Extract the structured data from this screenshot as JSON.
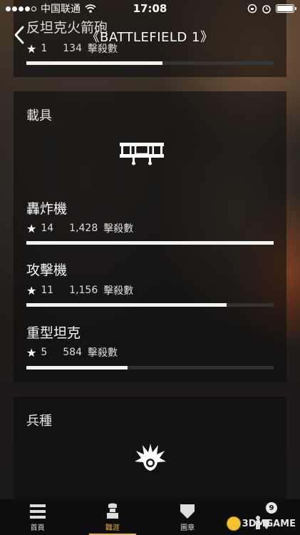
{
  "status_bar": {
    "carrier": "中国联通",
    "time": "17:08"
  },
  "header": {
    "title": "《BATTLEFIELD 1》"
  },
  "top_card": {
    "name": "反坦克火箭砲",
    "rank": "1",
    "kills": "134",
    "kills_label": "擊殺數",
    "progress": 0.55
  },
  "vehicle_card": {
    "title": "載具",
    "icon": "biplane-icon",
    "items": [
      {
        "name": "轟炸機",
        "rank": "14",
        "kills": "1,428",
        "kills_label": "擊殺數",
        "progress": 1.0
      },
      {
        "name": "攻擊機",
        "rank": "11",
        "kills": "1,156",
        "kills_label": "擊殺數",
        "progress": 0.81
      },
      {
        "name": "重型坦克",
        "rank": "5",
        "kills": "584",
        "kills_label": "擊殺數",
        "progress": 0.41
      }
    ]
  },
  "class_card": {
    "title": "兵種",
    "icon": "assault-burst-icon"
  },
  "nav": {
    "items": [
      {
        "label": "首頁",
        "icon": "list-icon"
      },
      {
        "label": "職涯",
        "icon": "soldier-icon"
      },
      {
        "label": "圖章",
        "icon": "emblem-icon"
      },
      {
        "label": "",
        "icon": "friends-icon"
      }
    ],
    "active": 1,
    "badge": "9"
  },
  "watermark": "3DMGAME",
  "colors": {
    "accent": "#f0b040",
    "bar": "#f2f2f2"
  }
}
